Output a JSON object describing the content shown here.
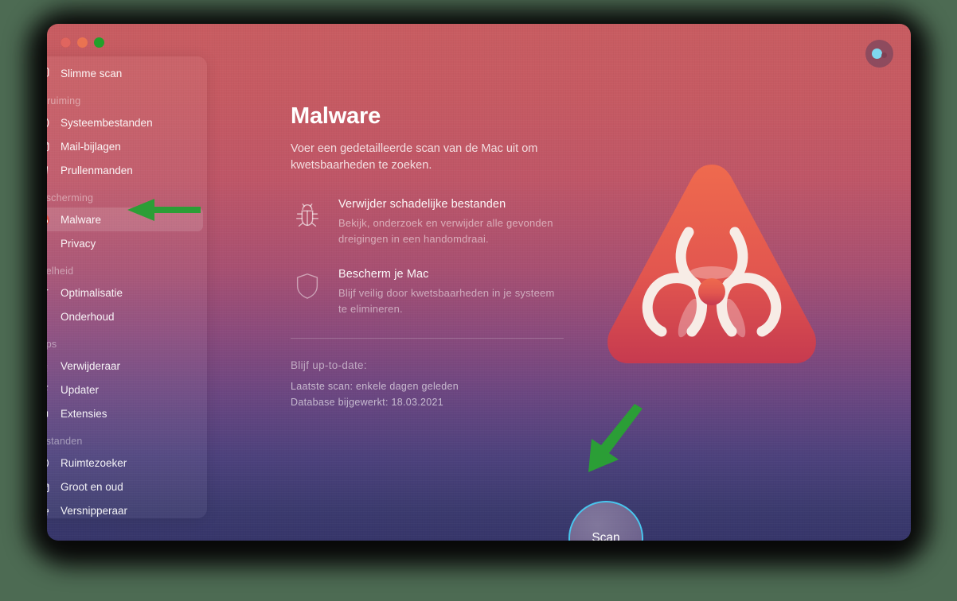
{
  "window": {
    "traffic_lights": [
      "close",
      "minimize",
      "zoom"
    ],
    "topright": {
      "name": "account-status-button"
    }
  },
  "sidebar": {
    "groups": [
      {
        "label": "",
        "items": [
          {
            "label": "Slimme scan",
            "icon": "smart-scan-icon",
            "selected": false
          }
        ]
      },
      {
        "label": "Opruiming",
        "items": [
          {
            "label": "Systeembestanden",
            "icon": "system-junk-icon",
            "selected": false
          },
          {
            "label": "Mail-bijlagen",
            "icon": "mail-icon",
            "selected": false
          },
          {
            "label": "Prullenmanden",
            "icon": "trash-icon",
            "selected": false
          }
        ]
      },
      {
        "label": "Bescherming",
        "items": [
          {
            "label": "Malware",
            "icon": "biohazard-icon",
            "selected": true
          },
          {
            "label": "Privacy",
            "icon": "hand-icon",
            "selected": false
          }
        ]
      },
      {
        "label": "Snelheid",
        "items": [
          {
            "label": "Optimalisatie",
            "icon": "sliders-icon",
            "selected": false
          },
          {
            "label": "Onderhoud",
            "icon": "wrench-icon",
            "selected": false
          }
        ]
      },
      {
        "label": "Apps",
        "items": [
          {
            "label": "Verwijderaar",
            "icon": "uninstaller-icon",
            "selected": false
          },
          {
            "label": "Updater",
            "icon": "updater-icon",
            "selected": false
          },
          {
            "label": "Extensies",
            "icon": "extensions-icon",
            "selected": false
          }
        ]
      },
      {
        "label": "Bestanden",
        "items": [
          {
            "label": "Ruimtezoeker",
            "icon": "space-lens-icon",
            "selected": false
          },
          {
            "label": "Groot en oud",
            "icon": "folder-icon",
            "selected": false
          },
          {
            "label": "Versnipperaar",
            "icon": "shredder-icon",
            "selected": false
          }
        ]
      }
    ]
  },
  "main": {
    "title": "Malware",
    "subtitle": "Voer een gedetailleerde scan van de Mac uit om kwetsbaarheden te zoeken.",
    "features": [
      {
        "icon": "bug-icon",
        "title": "Verwijder schadelijke bestanden",
        "desc": "Bekijk, onderzoek en verwijder alle gevonden dreigingen in een handomdraai."
      },
      {
        "icon": "shield-icon",
        "title": "Bescherm je Mac",
        "desc": "Blijf veilig door kwetsbaarheden in je systeem te elimineren."
      }
    ],
    "status_heading": "Blijf up-to-date:",
    "status_lines": [
      "Laatste scan: enkele dagen geleden",
      "Database bijgewerkt: 18.03.2021"
    ],
    "hero_icon": "biohazard-warning-triangle",
    "scan_button": "Scan"
  },
  "annotations": {
    "arrow_color": "#2b9e36",
    "arrows": [
      {
        "name": "arrow-pointing-to-malware-sidebar-item",
        "direction": "left"
      },
      {
        "name": "arrow-pointing-to-scan-button",
        "direction": "down-left"
      }
    ]
  },
  "colors": {
    "accent_ring": "#49c6ee",
    "window_top": "#c85c61",
    "window_bottom": "#36356a",
    "page_background": "#4d6b53",
    "hero_red": "#e8604a"
  }
}
